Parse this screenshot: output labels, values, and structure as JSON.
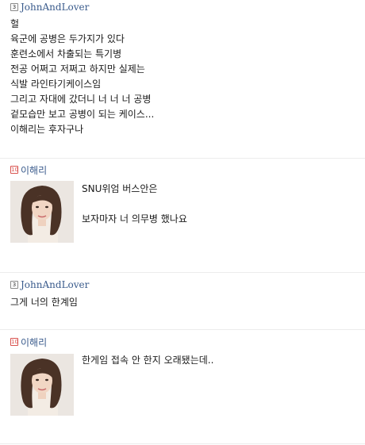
{
  "comments": [
    {
      "badge": "3",
      "user": "JohnAndLover",
      "lines": [
        "헐",
        "육군에 공병은 두가지가 있다",
        "훈련소에서 차출되는 특기병",
        "전공 어쩌고 저쩌고 하지만 실제는",
        "식발 라인타기케이스임",
        "그리고 자대에 갔더니 너 너 너 공병",
        "겉모습만 보고 공병이 되는 케이스...",
        "이해리는 후자구나"
      ]
    },
    {
      "badge": "10",
      "user": "이해리",
      "lines": [
        "SNU위엄 버스안은",
        "",
        "보자마자 너 의무병 했나요"
      ]
    },
    {
      "badge": "3",
      "user": "JohnAndLover",
      "lines": [
        "그게 너의 한계임"
      ]
    },
    {
      "badge": "10",
      "user": "이해리",
      "lines": [
        "한게임 접속 안 한지 오래됐는데.."
      ]
    }
  ],
  "colors": {
    "username": "#3a5b8c",
    "badge_red": "#d9534f",
    "divider": "#ececec"
  }
}
